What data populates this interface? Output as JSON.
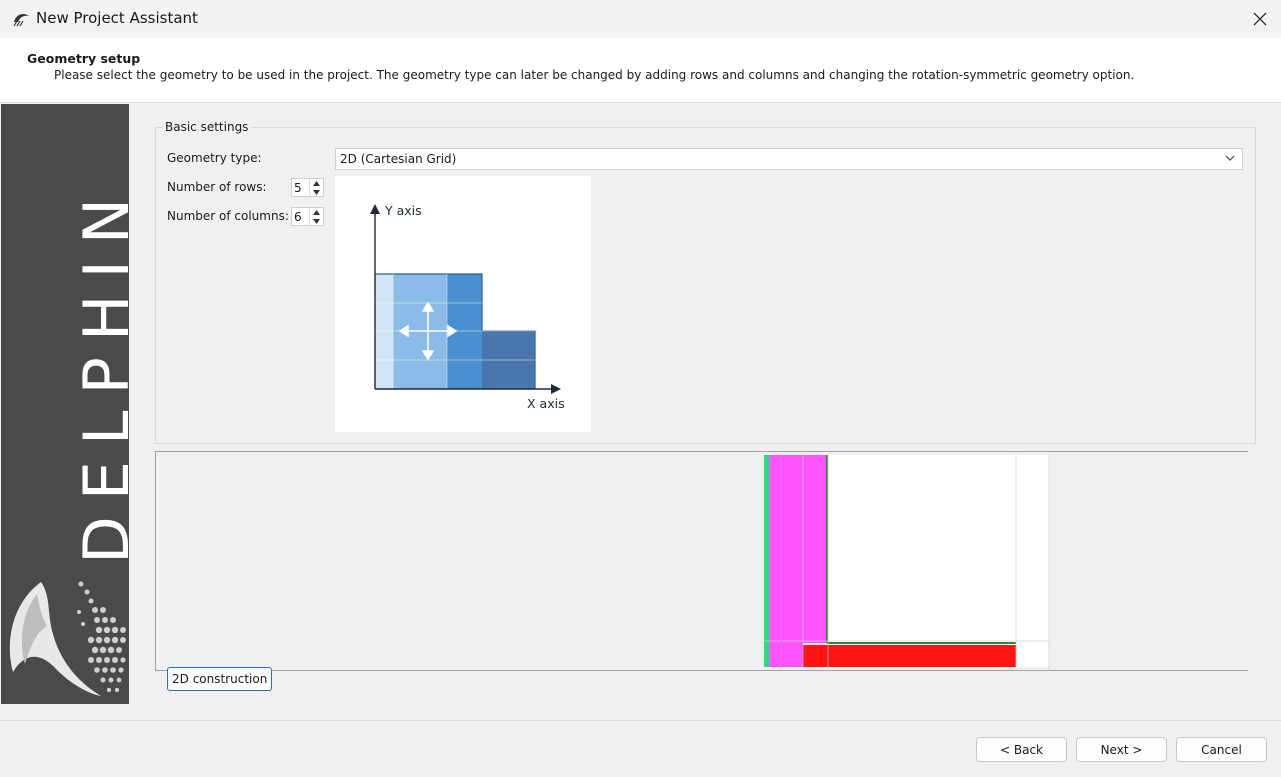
{
  "window": {
    "title": "New Project Assistant",
    "close_icon": "close-icon"
  },
  "header": {
    "title": "Geometry setup",
    "description": "Please select the geometry to be used in the project. The geometry type can later be changed by adding rows and columns and changing the rotation-symmetric geometry option."
  },
  "sidebar": {
    "brand": "DELPHIN",
    "logo_icon": "dolphin-logo-icon"
  },
  "basic_settings": {
    "legend": "Basic settings",
    "geometry_type_label": "Geometry type:",
    "geometry_type_value": "2D (Cartesian Grid)",
    "rows_label": "Number of rows:",
    "rows_value": "5",
    "columns_label": "Number of columns:",
    "columns_value": "6"
  },
  "diagram": {
    "y_axis_label": "Y axis",
    "x_axis_label": "X axis",
    "colors": {
      "light": "#d0e6f7",
      "mid": "#8abbe9",
      "strong": "#4a8fd0",
      "dark": "#4a76ad"
    }
  },
  "preview": {
    "construction_button": "2D construction",
    "colors": {
      "green": "#22e07a",
      "magenta": "#ff55ff",
      "red": "#ff1414"
    }
  },
  "footer": {
    "back_label": "< Back",
    "next_label": "Next >",
    "cancel_label": "Cancel"
  }
}
